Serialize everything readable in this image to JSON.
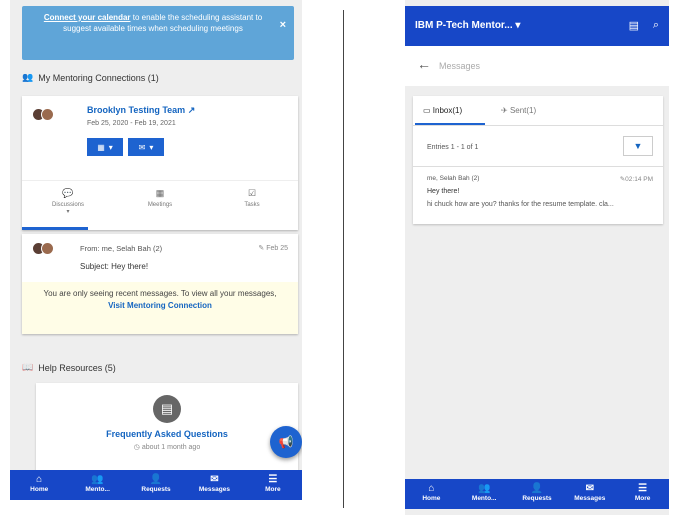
{
  "left": {
    "alert": {
      "link": "Connect your calendar",
      "text": "to enable the scheduling assistant to suggest available times when scheduling meetings",
      "close": "×"
    },
    "connections_title": "My Mentoring Connections (1)",
    "connection": {
      "name": "Brooklyn Testing Team",
      "dates": "Feb 25, 2020 - Feb 19, 2021",
      "tabs": [
        {
          "label": "Discussions",
          "icon": "comments-icon"
        },
        {
          "label": "Meetings",
          "icon": "calendar-icon"
        },
        {
          "label": "Tasks",
          "icon": "tasks-icon"
        }
      ]
    },
    "message": {
      "from": "From: me, Selah Bah (2)",
      "date": "Feb 25",
      "subject": "Subject: Hey there!"
    },
    "notice": {
      "text": "You are only seeing recent messages. To view all your messages,",
      "link": "Visit Mentoring Connection"
    },
    "help_title": "Help Resources (5)",
    "faq": {
      "title": "Frequently Asked Questions",
      "time": "about 1 month ago"
    }
  },
  "right": {
    "app_title": "IBM P-Tech Mentor...",
    "subheader": "Messages",
    "tabs": [
      {
        "label": "Inbox(1)",
        "icon": "inbox-icon"
      },
      {
        "label": "Sent(1)",
        "icon": "send-icon"
      }
    ],
    "entries": "Entries 1 - 1 of 1",
    "message": {
      "from": "me, Selah Bah (2)",
      "time": "02:14 PM",
      "subject": "Hey there!",
      "preview": "hi chuck how are you? thanks for the resume template. cla..."
    }
  },
  "nav": [
    {
      "label": "Home",
      "icon": "home-icon"
    },
    {
      "label": "Mento...",
      "icon": "users-icon"
    },
    {
      "label": "Requests",
      "icon": "add-user-icon"
    },
    {
      "label": "Messages",
      "icon": "envelope-icon"
    },
    {
      "label": "More",
      "icon": "menu-icon"
    }
  ],
  "colors": {
    "primary": "#1747c7",
    "alert": "#5fa5d8",
    "link": "#1565c0",
    "notice": "#fffde7"
  }
}
